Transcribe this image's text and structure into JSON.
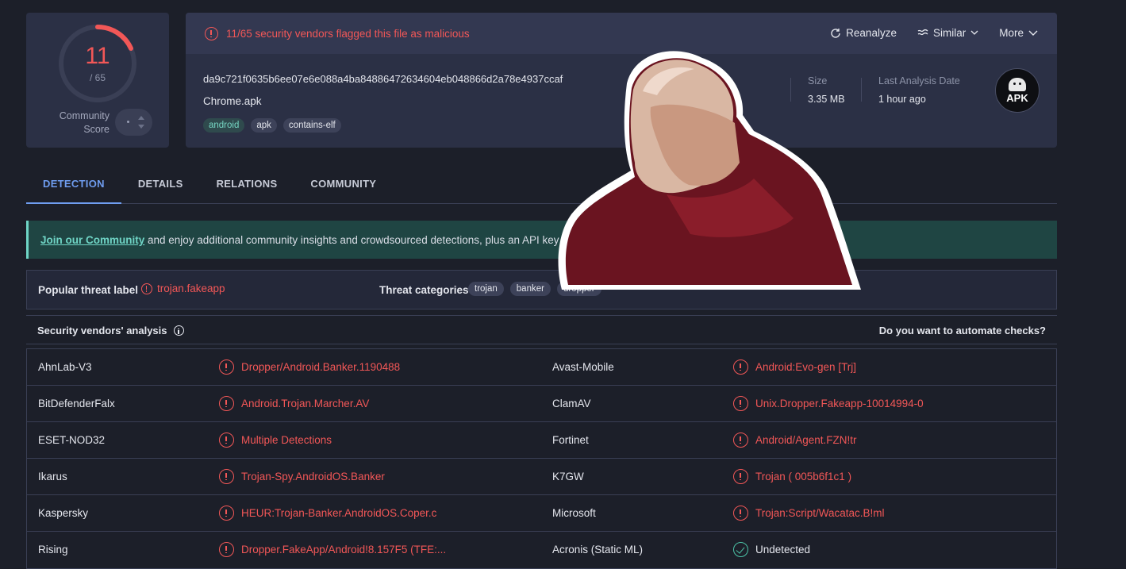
{
  "score": {
    "detections": "11",
    "total": "/ 65",
    "community_label_1": "Community",
    "community_label_2": "Score"
  },
  "header": {
    "warning": "11/65 security vendors flagged this file as malicious",
    "actions": [
      "Reanalyze",
      "Similar",
      "More"
    ]
  },
  "file": {
    "hash": "da9c721f0635b6ee07e6e088a4ba84886472634604eb048866d2a78e4937ccaf",
    "name": "Chrome.apk",
    "tags": [
      "android",
      "apk",
      "contains-elf"
    ],
    "size_label": "Size",
    "size": "3.35 MB",
    "date_label": "Last Analysis Date",
    "date": "1 hour ago",
    "type_badge": "APK"
  },
  "tabs": [
    "DETECTION",
    "DETAILS",
    "RELATIONS",
    "COMMUNITY"
  ],
  "banner": {
    "link": "Join our Community",
    "text": " and enjoy additional community insights and crowdsourced detections, plus an API key to a"
  },
  "threat": {
    "popular_label": "Popular threat label",
    "popular_value": "trojan.fakeapp",
    "categories_label": "Threat categories",
    "categories": [
      "trojan",
      "banker",
      "dropper"
    ]
  },
  "analysis": {
    "title": "Security vendors' analysis",
    "automate": "Do you want to automate checks?"
  },
  "vendors": [
    {
      "left": {
        "name": "AhnLab-V3",
        "result": "Dropper/Android.Banker.1190488"
      },
      "right": {
        "name": "Avast-Mobile",
        "result": "Android:Evo-gen [Trj]"
      }
    },
    {
      "left": {
        "name": "BitDefenderFalx",
        "result": "Android.Trojan.Marcher.AV"
      },
      "right": {
        "name": "ClamAV",
        "result": "Unix.Dropper.Fakeapp-10014994-0"
      }
    },
    {
      "left": {
        "name": "ESET-NOD32",
        "result": "Multiple Detections"
      },
      "right": {
        "name": "Fortinet",
        "result": "Android/Agent.FZN!tr"
      }
    },
    {
      "left": {
        "name": "Ikarus",
        "result": "Trojan-Spy.AndroidOS.Banker"
      },
      "right": {
        "name": "K7GW",
        "result": "Trojan ( 005b6f1c1 )"
      }
    },
    {
      "left": {
        "name": "Kaspersky",
        "result": "HEUR:Trojan-Banker.AndroidOS.Coper.c"
      },
      "right": {
        "name": "Microsoft",
        "result": "Trojan:Script/Wacatac.B!ml"
      }
    },
    {
      "left": {
        "name": "Rising",
        "result": "Dropper.FakeApp/Android!8.157F5 (TFE:..."
      },
      "right": {
        "name": "Acronis (Static ML)",
        "result": "Undetected"
      }
    }
  ],
  "colors": {
    "malicious": "#f25757",
    "accent": "#6f9df0",
    "banner": "#1f4543",
    "clean": "#4cc3a7"
  }
}
